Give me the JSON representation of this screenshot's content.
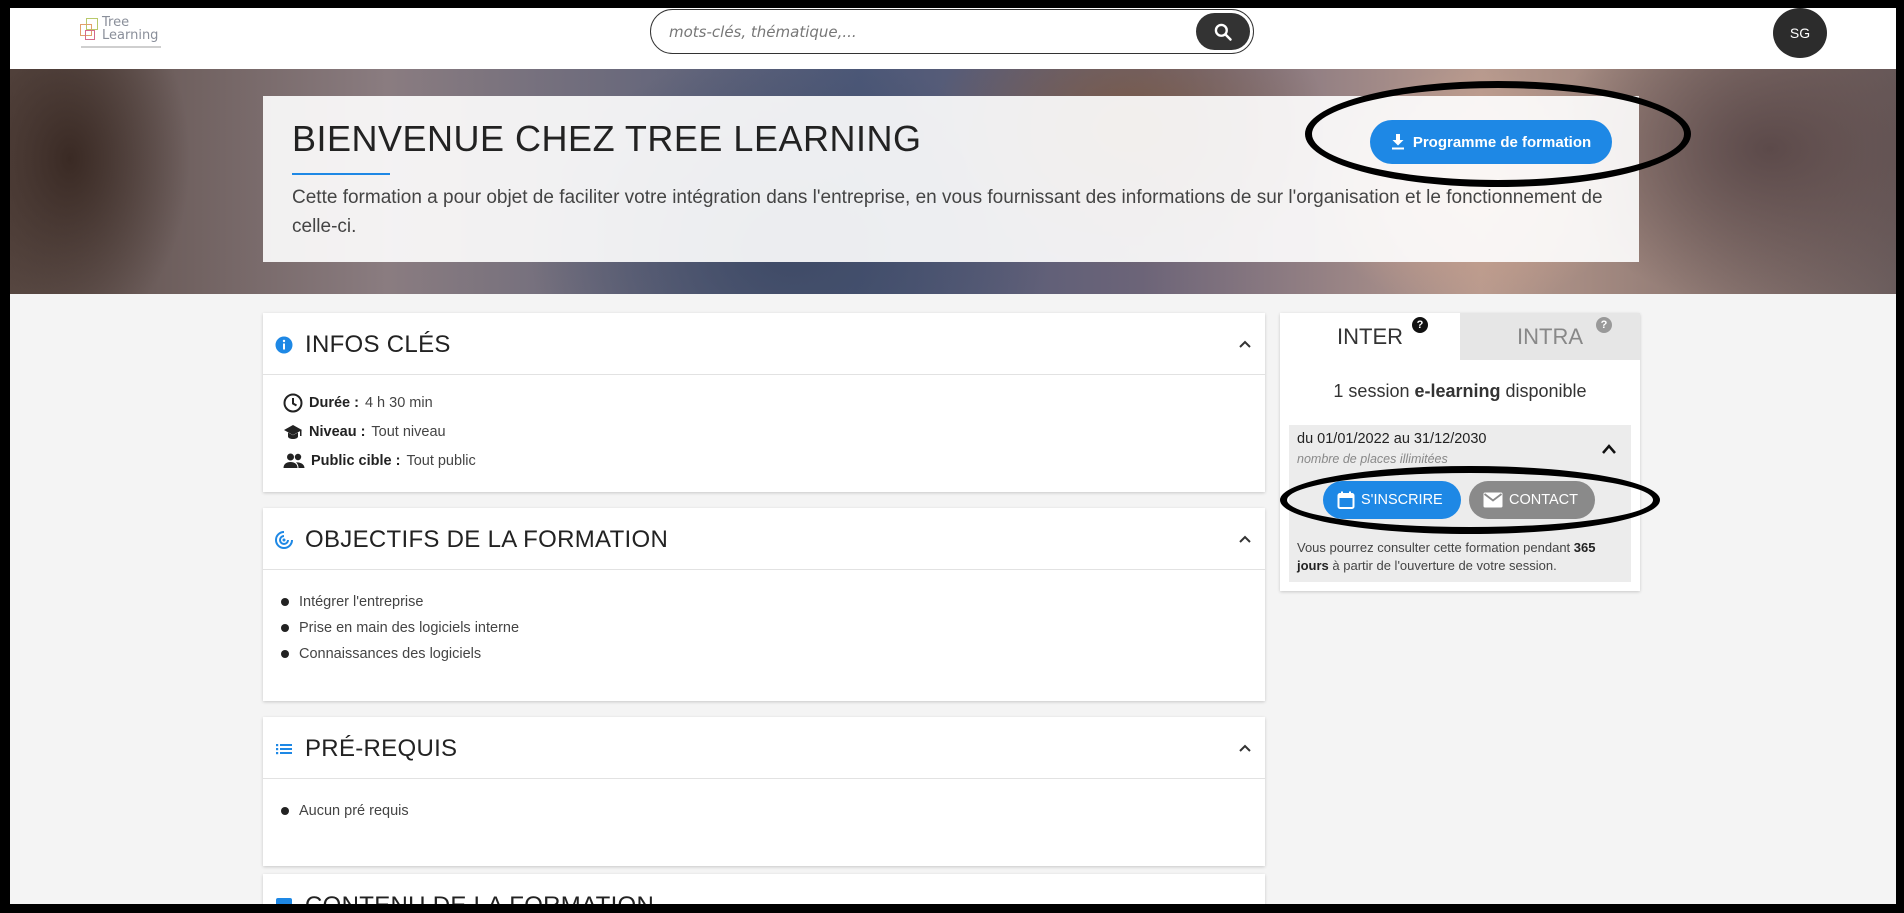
{
  "header": {
    "logo_line1": "Tree",
    "logo_line2": "Learning",
    "search_placeholder": "mots-clés, thématique,...",
    "avatar_initials": "SG"
  },
  "hero": {
    "title": "BIENVENUE CHEZ TREE LEARNING",
    "description": "Cette formation a pour objet de faciliter votre intégration dans l'entreprise, en vous fournissant des informations de sur l'organisation et le fonctionnement de celle-ci.",
    "program_button_label": "Programme de formation"
  },
  "infos": {
    "title": "INFOS CLÉS",
    "duration_label": "Durée :",
    "duration_value": "4 h 30 min",
    "level_label": "Niveau :",
    "level_value": "Tout niveau",
    "audience_label": "Public cible :",
    "audience_value": "Tout public"
  },
  "objectives": {
    "title": "OBJECTIFS DE LA FORMATION",
    "items": [
      "Intégrer l'entreprise",
      "Prise en main des logiciels interne",
      "Connaissances des logiciels"
    ]
  },
  "prereq": {
    "title": "PRÉ-REQUIS",
    "items": [
      "Aucun pré requis"
    ]
  },
  "content": {
    "title": "CONTENU DE LA FORMATION"
  },
  "side": {
    "tab_inter": "INTER",
    "tab_intra": "INTRA",
    "session_prefix": "1 session ",
    "session_bold": "e-learning",
    "session_suffix": " disponible",
    "dates": "du 01/01/2022 au 31/12/2030",
    "places": "nombre de places illimitées",
    "register_label": "S'INSCRIRE",
    "contact_label": "CONTACT",
    "note_prefix": "Vous pourrez consulter cette formation pendant ",
    "note_bold": "365 jours",
    "note_suffix": " à partir de l'ouverture de votre session."
  },
  "colors": {
    "accent": "#1e88e5",
    "dark": "#2c2c2c",
    "contact_grey": "#8a8a8a"
  }
}
